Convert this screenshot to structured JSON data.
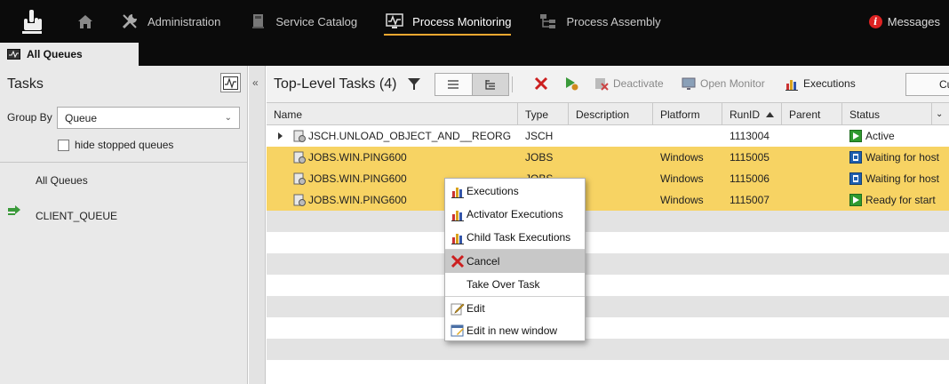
{
  "nav": {
    "items": [
      {
        "label": "Administration",
        "icon": "wrench-icon"
      },
      {
        "label": "Service Catalog",
        "icon": "catalog-icon"
      },
      {
        "label": "Process Monitoring",
        "icon": "monitor-icon",
        "active": true
      },
      {
        "label": "Process Assembly",
        "icon": "assembly-icon"
      }
    ],
    "messages": "Messages",
    "accent": "#f0a830"
  },
  "tab": {
    "label": "All Queues"
  },
  "left": {
    "title": "Tasks",
    "group_by_label": "Group By",
    "group_by_value": "Queue",
    "hide_stopped": "hide stopped queues",
    "tree": [
      "All Queues",
      "CLIENT_QUEUE"
    ]
  },
  "right": {
    "title": "Top-Level Tasks (4)",
    "toolbar": {
      "deactivate": "Deactivate",
      "open_monitor": "Open Monitor",
      "executions": "Executions",
      "cut": "Cu"
    }
  },
  "table": {
    "columns": [
      "Name",
      "Type",
      "Description",
      "Platform",
      "RunID",
      "Parent",
      "Status"
    ],
    "rows": [
      {
        "name": "JSCH.UNLOAD_OBJECT_AND__REORG",
        "type": "JSCH",
        "description": "",
        "platform": "",
        "runid": "1113004",
        "parent": "",
        "status": "Active",
        "selected": false
      },
      {
        "name": "JOBS.WIN.PING600",
        "type": "JOBS",
        "description": "",
        "platform": "Windows",
        "runid": "1115005",
        "parent": "",
        "status": "Waiting for host",
        "selected": true
      },
      {
        "name": "JOBS.WIN.PING600",
        "type": "JOBS",
        "description": "",
        "platform": "Windows",
        "runid": "1115006",
        "parent": "",
        "status": "Waiting for host",
        "selected": true
      },
      {
        "name": "JOBS.WIN.PING600",
        "type": "JOBS",
        "description": "",
        "platform": "Windows",
        "runid": "1115007",
        "parent": "",
        "status": "Ready for start",
        "selected": true
      }
    ],
    "selected_color": "#f7d363"
  },
  "context_menu": {
    "items": [
      "Executions",
      "Activator Executions",
      "Child Task Executions",
      "Cancel",
      "Take Over Task",
      "Edit",
      "Edit in new window"
    ],
    "highlighted": "Cancel"
  }
}
